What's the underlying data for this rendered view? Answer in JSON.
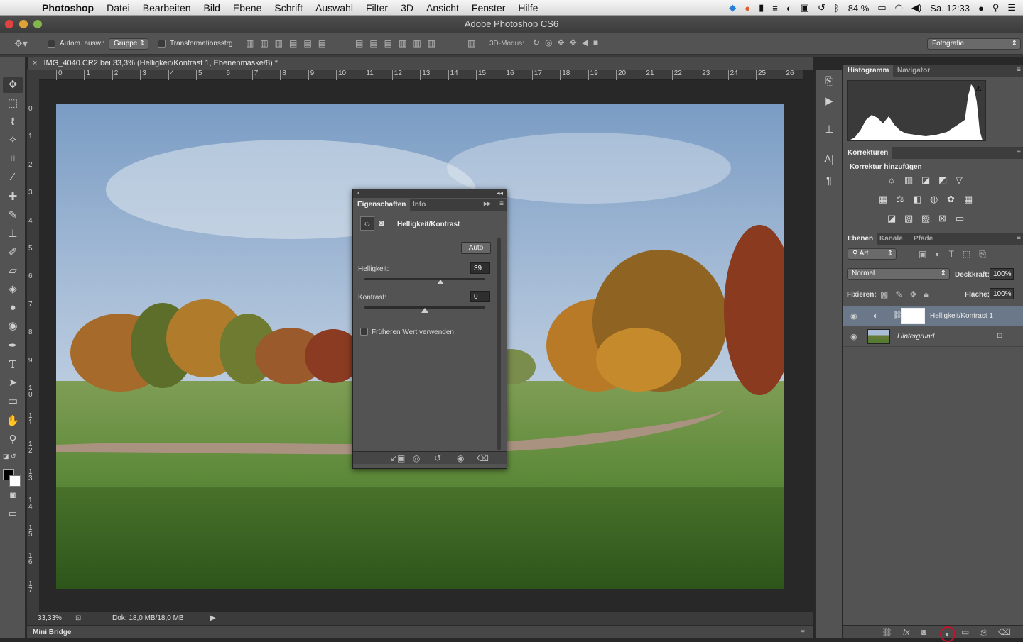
{
  "menubar": {
    "app": "Photoshop",
    "items": [
      "Datei",
      "Bearbeiten",
      "Bild",
      "Ebene",
      "Schrift",
      "Auswahl",
      "Filter",
      "3D",
      "Ansicht",
      "Fenster",
      "Hilfe"
    ],
    "battery": "84 %",
    "clock": "Sa. 12:33"
  },
  "window": {
    "title": "Adobe Photoshop CS6"
  },
  "options": {
    "auto_select_label": "Autom. ausw.:",
    "group_value": "Gruppe",
    "transform_label": "Transformationsstrg.",
    "mode3d_label": "3D-Modus:",
    "workspace": "Fotografie"
  },
  "document": {
    "tab_title": "IMG_4040.CR2 bei 33,3% (Helligkeit/Kontrast 1, Ebenenmaske/8) *",
    "ruler_top": [
      "0",
      "1",
      "2",
      "3",
      "4",
      "5",
      "6",
      "7",
      "8",
      "9",
      "10",
      "11",
      "12",
      "13",
      "14",
      "15",
      "16",
      "17",
      "18",
      "19",
      "20",
      "21",
      "22",
      "23",
      "24",
      "25",
      "26"
    ],
    "ruler_left": [
      "0",
      "1",
      "2",
      "3",
      "4",
      "5",
      "6",
      "7",
      "8",
      "9",
      "10",
      "11",
      "12",
      "13",
      "14",
      "15",
      "16",
      "17"
    ]
  },
  "status": {
    "zoom": "33,33%",
    "doc_size": "Dok: 18,0 MB/18,0 MB"
  },
  "minibridge": {
    "label": "Mini Bridge"
  },
  "properties": {
    "tabs": [
      "Eigenschaften",
      "Info"
    ],
    "title": "Helligkeit/Kontrast",
    "auto_button": "Auto",
    "brightness_label": "Helligkeit:",
    "brightness_value": "39",
    "contrast_label": "Kontrast:",
    "contrast_value": "0",
    "legacy_label": "Früheren Wert verwenden"
  },
  "panels": {
    "histogram_tabs": [
      "Histogramm",
      "Navigator"
    ],
    "corrections_tab": "Korrekturen",
    "corrections_heading": "Korrektur hinzufügen",
    "layers_tabs": [
      "Ebenen",
      "Kanäle",
      "Pfade"
    ],
    "filter_kind": "Art",
    "blend_mode": "Normal",
    "opacity_label": "Deckkraft:",
    "opacity_value": "100%",
    "lock_label": "Fixieren:",
    "fill_label": "Fläche:",
    "fill_value": "100%",
    "layers": [
      {
        "name": "Helligkeit/Kontrast 1"
      },
      {
        "name": "Hintergrund"
      }
    ]
  }
}
